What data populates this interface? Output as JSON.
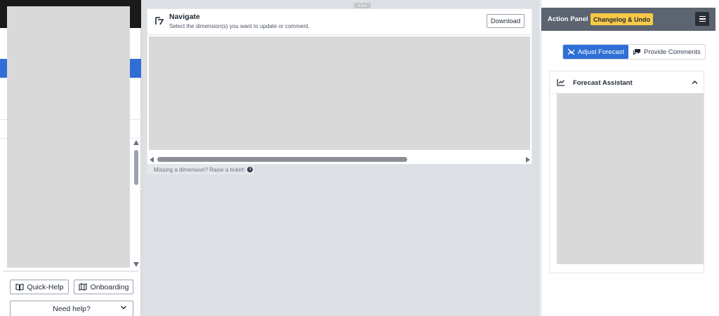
{
  "sidebar": {
    "quick_help_label": "Quick-Help",
    "onboarding_label": "Onboarding",
    "need_help_label": "Need help?"
  },
  "navigate": {
    "title": "Navigate",
    "subtitle": "Select the dimension(s) you want to update or comment.",
    "download_label": "Download",
    "missing_dimension_text": "Missing a dimension? Raise a ticket!"
  },
  "action_panel": {
    "title": "Action Panel",
    "changelog_label": "Changelog & Undo",
    "tabs": [
      {
        "label": "Adjust Forecast",
        "active": true
      },
      {
        "label": "Provide Comments",
        "active": false
      }
    ],
    "assistant_title": "Forecast Assistant"
  },
  "colors": {
    "accent_blue": "#2f6fd6",
    "panel_header": "#5b6470",
    "changelog_badge": "#f7c948",
    "main_background": "#dcdfe4"
  },
  "icons": {
    "quick_help": "book-open-icon",
    "onboarding": "map-icon",
    "navigate": "navigate-icon",
    "adjust_forecast": "chart-adjust-icon",
    "provide_comments": "comments-icon",
    "forecast_assistant": "chart-line-icon"
  }
}
